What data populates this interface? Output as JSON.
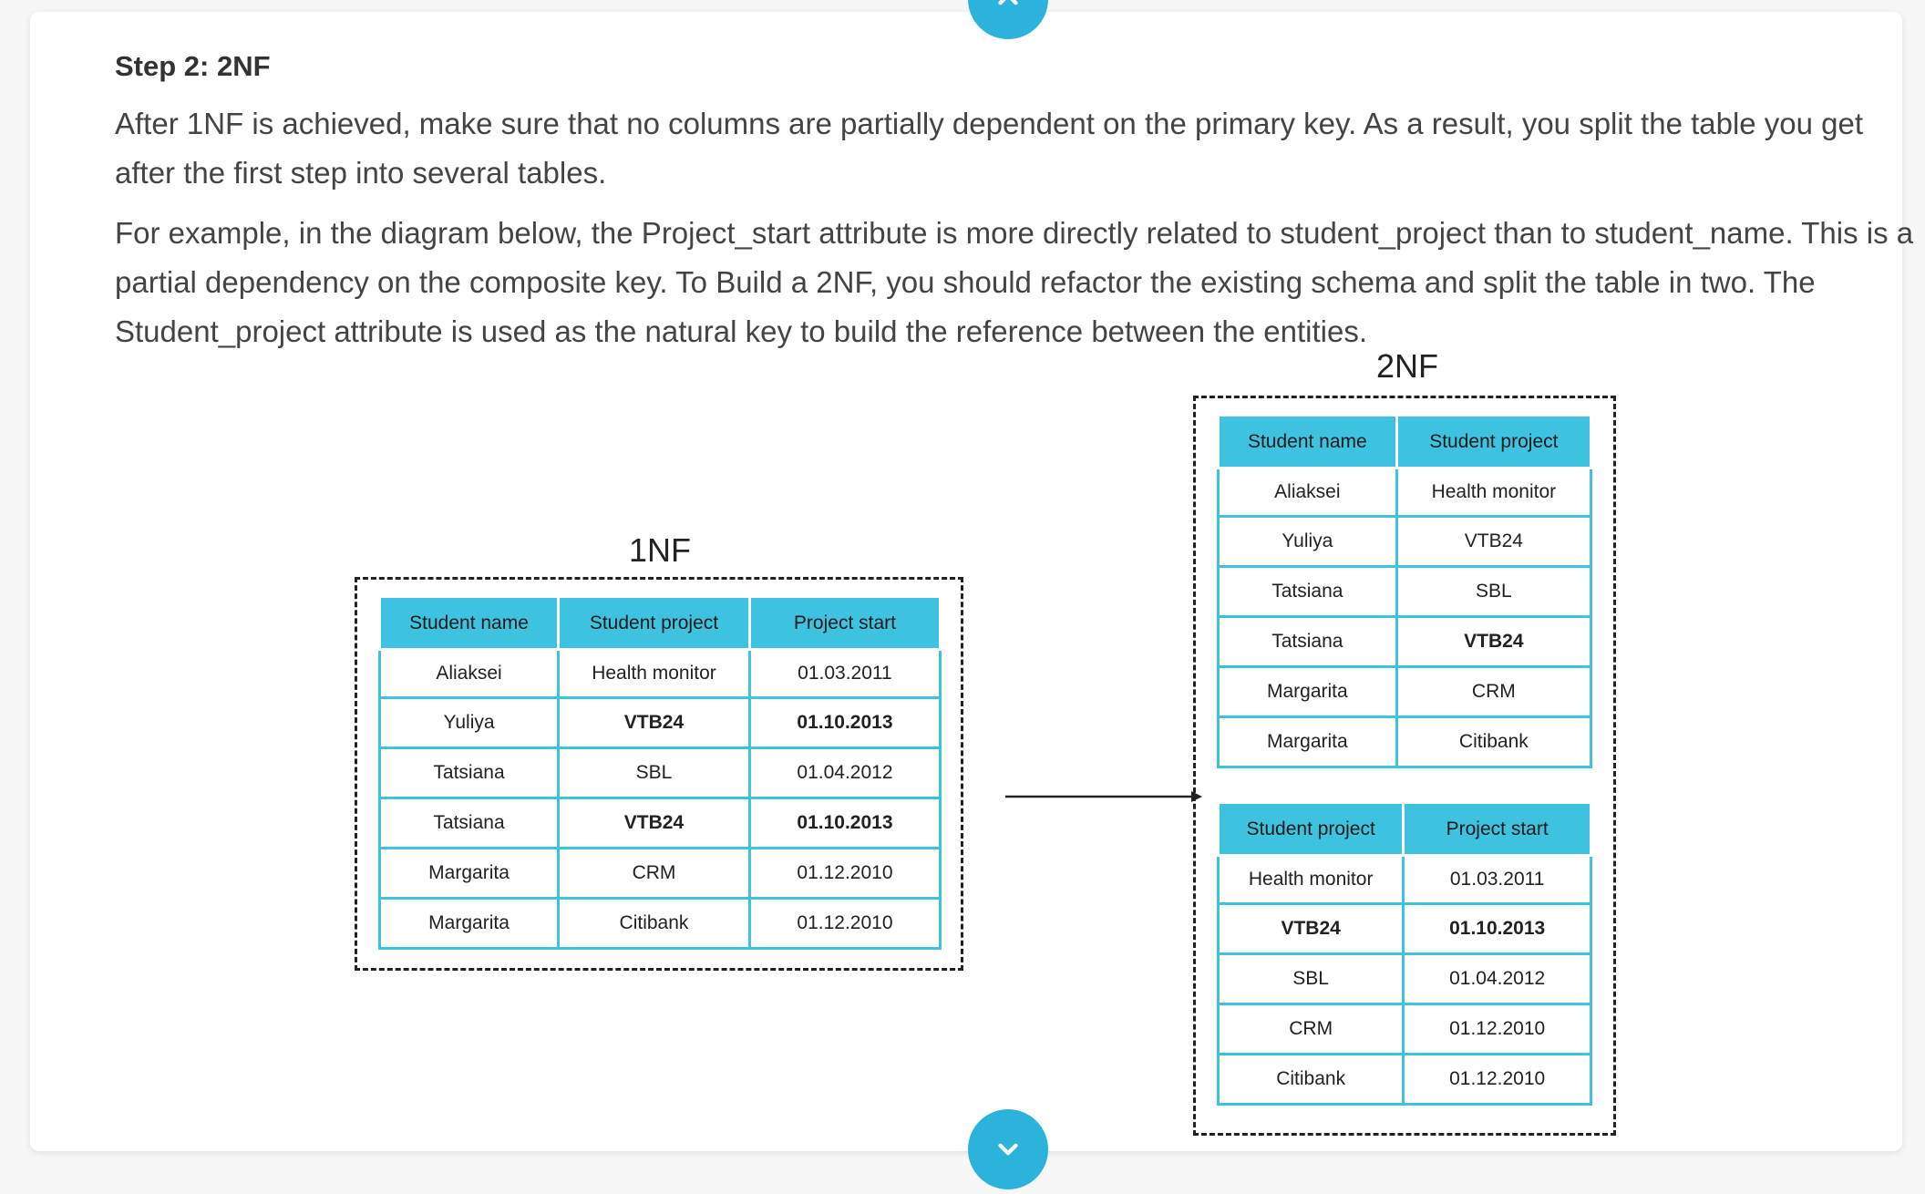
{
  "step": {
    "heading": "Step 2: 2NF",
    "paragraph1": "After 1NF is achieved, make sure that no columns are partially dependent on the primary key. As a result, you split the table you get after the first step into several tables.",
    "paragraph2": "For example, in the diagram below, the Project_start attribute is more directly related to student_project than to student_name. This is a partial dependency on the composite key. To Build a 2NF, you should refactor the existing schema and split the table in two. The Student_project attribute is used as the natural key to build the reference between the entities."
  },
  "diagram": {
    "left_label": "1NF",
    "right_label": "2NF",
    "table_1nf": {
      "headers": [
        "Student name",
        "Student project",
        "Project start"
      ],
      "rows": [
        [
          "Aliaksei",
          "Health monitor",
          "01.03.2011"
        ],
        [
          "Yuliya",
          "VTB24",
          "01.10.2013"
        ],
        [
          "Tatsiana",
          "SBL",
          "01.04.2012"
        ],
        [
          "Tatsiana",
          "VTB24",
          "01.10.2013"
        ],
        [
          "Margarita",
          "CRM",
          "01.12.2010"
        ],
        [
          "Margarita",
          "Citibank",
          "01.12.2010"
        ]
      ]
    },
    "table_2nf_a": {
      "headers": [
        "Student name",
        "Student project"
      ],
      "rows": [
        [
          "Aliaksei",
          "Health monitor"
        ],
        [
          "Yuliya",
          "VTB24"
        ],
        [
          "Tatsiana",
          "SBL"
        ],
        [
          "Tatsiana",
          "VTB24"
        ],
        [
          "Margarita",
          "CRM"
        ],
        [
          "Margarita",
          "Citibank"
        ]
      ]
    },
    "table_2nf_b": {
      "headers": [
        "Student project",
        "Project start"
      ],
      "rows": [
        [
          "Health monitor",
          "01.03.2011"
        ],
        [
          "VTB24",
          "01.10.2013"
        ],
        [
          "SBL",
          "01.04.2012"
        ],
        [
          "CRM",
          "01.12.2010"
        ],
        [
          "Citibank",
          "01.12.2010"
        ]
      ]
    }
  },
  "icons": {
    "top_nav": "chevron-up-icon",
    "bottom_nav": "chevron-down-icon",
    "arrow": "arrow-right-icon"
  },
  "colors": {
    "accent": "#2bb3dc",
    "table_header": "#3dc2df",
    "table_border": "#3dc2df"
  }
}
